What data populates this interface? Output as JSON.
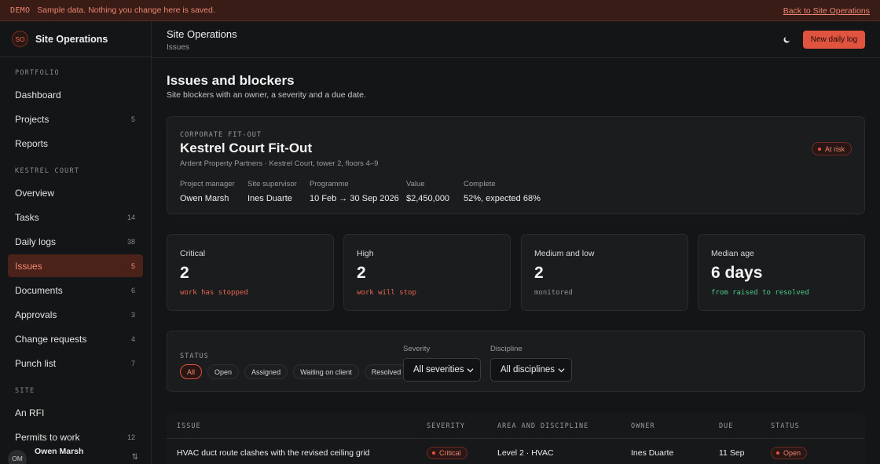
{
  "banner": {
    "tag": "DEMO",
    "message": "Sample data. Nothing you change here is saved.",
    "back_link": "Back to Site Operations"
  },
  "brand": {
    "initials": "SO",
    "name": "Site Operations"
  },
  "sidebar": {
    "sections": [
      {
        "label": "PORTFOLIO",
        "items": [
          {
            "label": "Dashboard",
            "count": ""
          },
          {
            "label": "Projects",
            "count": "5"
          },
          {
            "label": "Reports",
            "count": ""
          }
        ]
      },
      {
        "label": "KESTREL COURT",
        "items": [
          {
            "label": "Overview",
            "count": ""
          },
          {
            "label": "Tasks",
            "count": "14"
          },
          {
            "label": "Daily logs",
            "count": "38"
          },
          {
            "label": "Issues",
            "count": "5",
            "active": true
          },
          {
            "label": "Documents",
            "count": "6"
          },
          {
            "label": "Approvals",
            "count": "3"
          },
          {
            "label": "Change requests",
            "count": "4"
          },
          {
            "label": "Punch list",
            "count": "7"
          }
        ]
      },
      {
        "label": "SITE",
        "items": [
          {
            "label": "An RFI",
            "count": ""
          },
          {
            "label": "Permits to work",
            "count": "12"
          }
        ]
      }
    ],
    "user": {
      "initials": "OM",
      "name": "Owen Marsh",
      "switch_icon": "switch-icon"
    }
  },
  "header": {
    "title": "Site Operations",
    "breadcrumb": "Issues",
    "theme_icon": "moon-icon",
    "new_button": "New daily log"
  },
  "page": {
    "title": "Issues and blockers",
    "subtitle": "Site blockers with an owner, a severity and a due date."
  },
  "project": {
    "kicker": "CORPORATE FIT-OUT",
    "name": "Kestrel Court Fit-Out",
    "client": "Ardent Property Partners · Kestrel Court, tower 2, floors 4–9",
    "status": "At risk",
    "meta": [
      {
        "label": "Project manager",
        "value": "Owen Marsh"
      },
      {
        "label": "Site supervisor",
        "value": "Ines Duarte"
      },
      {
        "label": "Programme",
        "value": "10 Feb → 30 Sep 2026"
      },
      {
        "label": "Value",
        "value": "$2,450,000"
      },
      {
        "label": "Complete",
        "value": "52%, expected 68%"
      }
    ]
  },
  "stats": [
    {
      "label": "Critical",
      "value": "2",
      "note": "work has stopped",
      "tone": "red"
    },
    {
      "label": "High",
      "value": "2",
      "note": "work will stop",
      "tone": "red"
    },
    {
      "label": "Medium and low",
      "value": "2",
      "note": "monitored",
      "tone": "grey"
    },
    {
      "label": "Median age",
      "value": "6 days",
      "note": "from raised to resolved",
      "tone": "green"
    }
  ],
  "filters": {
    "status_label": "STATUS",
    "chips": [
      "All",
      "Open",
      "Assigned",
      "Waiting on client",
      "Resolved"
    ],
    "active_chip": "All",
    "severity": {
      "label": "Severity",
      "value": "All severities"
    },
    "discipline": {
      "label": "Discipline",
      "value": "All disciplines"
    }
  },
  "table": {
    "columns": [
      "ISSUE",
      "SEVERITY",
      "AREA AND DISCIPLINE",
      "OWNER",
      "DUE",
      "STATUS"
    ],
    "rows": [
      {
        "issue": "HVAC duct route clashes with the revised ceiling grid",
        "severity": "Critical",
        "area": "Level 2 · HVAC",
        "owner": "Ines Duarte",
        "due": "11 Sep",
        "status": "Open"
      }
    ]
  },
  "colors": {
    "accent": "#e0533f",
    "accent_text": "#f08a72",
    "background": "#141516",
    "card": "#1b1c1e",
    "success": "#4fc98a"
  }
}
